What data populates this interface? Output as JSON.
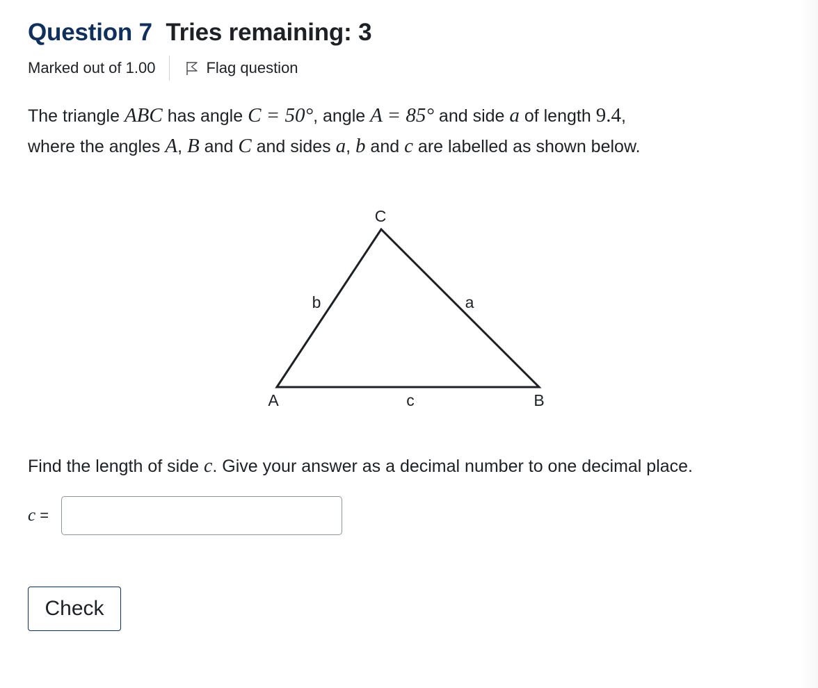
{
  "question": {
    "word": "Question",
    "number": "7",
    "tries": "Tries remaining: 3",
    "marked_out_of": "Marked out of 1.00",
    "flag_label": "Flag question"
  },
  "text": {
    "t1": "The  triangle ",
    "abc": "ABC",
    "t2": " has angle ",
    "c_eq": "C = 50°",
    "t3": ", angle ",
    "a_eq": "A = 85°",
    "t4": " and side ",
    "a": "a",
    "t5": " of length ",
    "len": "9.4",
    "t6": ",",
    "t7": "where the angles ",
    "A": "A",
    "t8": ", ",
    "B": "B",
    "t9": " and ",
    "C": "C",
    "t10": " and sides ",
    "sa": "a",
    "t11": ", ",
    "sb": "b",
    "t12": " and ",
    "sc": "c",
    "t13": " are labelled as shown below."
  },
  "diagram": {
    "vertex_A": "A",
    "vertex_B": "B",
    "vertex_C": "C",
    "side_a": "a",
    "side_b": "b",
    "side_c": "c"
  },
  "find": {
    "t1": "Find the length of side ",
    "c": "c",
    "t2": ". Give your answer as a decimal number to one decimal place."
  },
  "answer": {
    "label_var": "c",
    "label_eq": " =",
    "value": ""
  },
  "check_label": "Check",
  "colors": {
    "heading_blue": "#0f2f5c",
    "text": "#1d2125",
    "input_border": "#8f959e"
  }
}
